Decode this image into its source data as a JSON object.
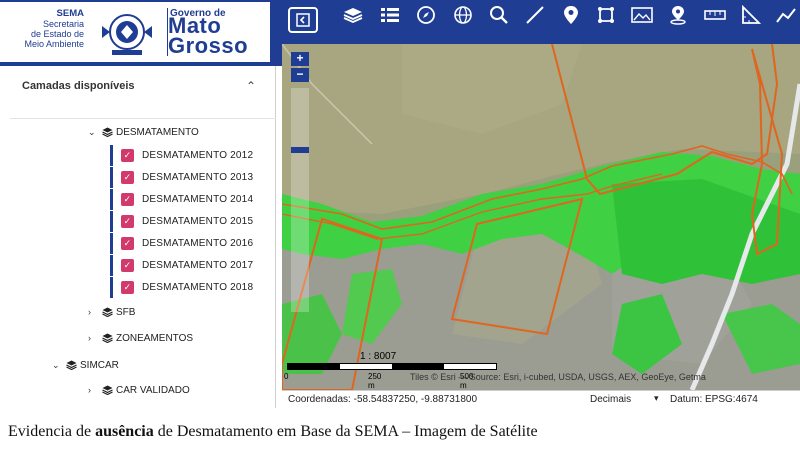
{
  "header": {
    "sema_logo_lines": [
      "SEMA",
      "Secretaria",
      "de Estado de",
      "Meio Ambiente"
    ],
    "gov_logo_small": "Governo de",
    "gov_logo_line1": "Mato",
    "gov_logo_line2": "Grosso",
    "toolbar_icons": [
      "collapse-panel-icon",
      "layers-icon",
      "list-icon",
      "compass-icon",
      "globe-icon",
      "search-icon",
      "measure-line-icon",
      "location-pin-icon",
      "draw-polygon-icon",
      "map-image-icon",
      "place-marker-icon",
      "ruler-icon",
      "angle-icon",
      "chart-icon"
    ]
  },
  "sidebar": {
    "title": "Camadas disponíveis",
    "groups": [
      {
        "label": "DESMATAMENTO",
        "expanded": true
      },
      {
        "label": "SFB",
        "expanded": false
      },
      {
        "label": "ZONEAMENTOS",
        "expanded": false
      },
      {
        "label": "SIMCAR",
        "expanded": true
      },
      {
        "label": "CAR VALIDADO",
        "expanded": false
      }
    ],
    "layers": [
      {
        "label": "DESMATAMENTO 2012",
        "checked": true
      },
      {
        "label": "DESMATAMENTO 2013",
        "checked": true
      },
      {
        "label": "DESMATAMENTO 2014",
        "checked": true
      },
      {
        "label": "DESMATAMENTO 2015",
        "checked": true
      },
      {
        "label": "DESMATAMENTO 2016",
        "checked": true
      },
      {
        "label": "DESMATAMENTO 2017",
        "checked": true
      },
      {
        "label": "DESMATAMENTO 2018",
        "checked": true
      }
    ]
  },
  "map": {
    "zoom_in": "+",
    "zoom_out": "−",
    "scale_ratio": "1 : 8007",
    "scale_ticks": [
      "0",
      "250 m",
      "500 m"
    ],
    "attribution": "Tiles © Esri — Source: Esri, i-cubed, USDA, USGS, AEX, GeoEye, Getma"
  },
  "statusbar": {
    "coords_label": "Coordenadas:",
    "coords_value": "-58.54837250, -9.88731800",
    "projection": "Decimais",
    "datum": "Datum: EPSG:4674"
  },
  "caption": {
    "part1": "Evidencia de ",
    "bold": "ausência",
    "part2": " de Desmatamento em Base da SEMA – Imagem de Satélite"
  },
  "colors": {
    "brand_blue": "#1f3d92",
    "checkbox": "#d23a6c",
    "polygon_outline": "#e0651e",
    "vegetation": "#2fd33e"
  }
}
